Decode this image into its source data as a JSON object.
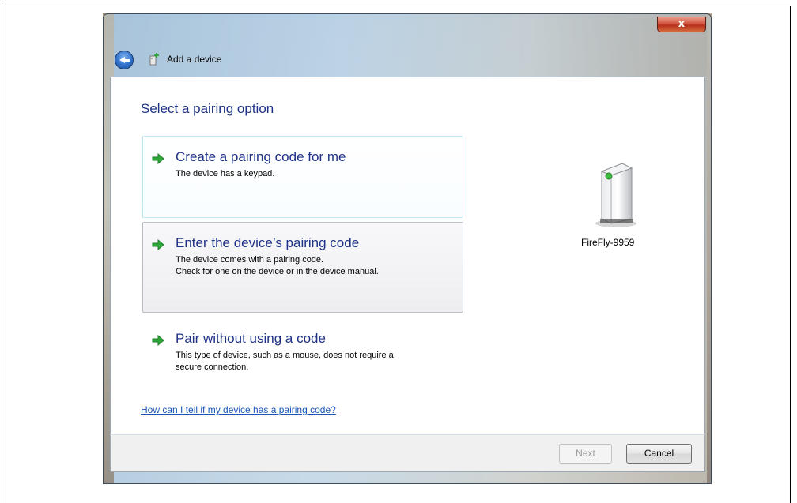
{
  "window": {
    "title": "Add a device",
    "close_label": "x"
  },
  "main": {
    "heading": "Select a pairing option",
    "options": [
      {
        "title": "Create a pairing code for me",
        "lines": [
          "The device has a keypad."
        ]
      },
      {
        "title": "Enter the device’s pairing code",
        "lines": [
          "The device comes with a pairing code.",
          "Check for one on the device or in the device manual."
        ]
      },
      {
        "title": "Pair without using a code",
        "lines": [
          "This type of device, such as a mouse, does not require a",
          "secure connection."
        ]
      }
    ],
    "help_link": "How can I tell if my device has a pairing code?"
  },
  "device": {
    "name": "FireFly-9959",
    "icon": "device-tower-icon"
  },
  "footer": {
    "next_label": "Next",
    "cancel_label": "Cancel"
  },
  "colors": {
    "accent_text": "#1e3287",
    "link": "#1a56b8",
    "arrow": "#2fa83a",
    "close": "#c8452e"
  }
}
